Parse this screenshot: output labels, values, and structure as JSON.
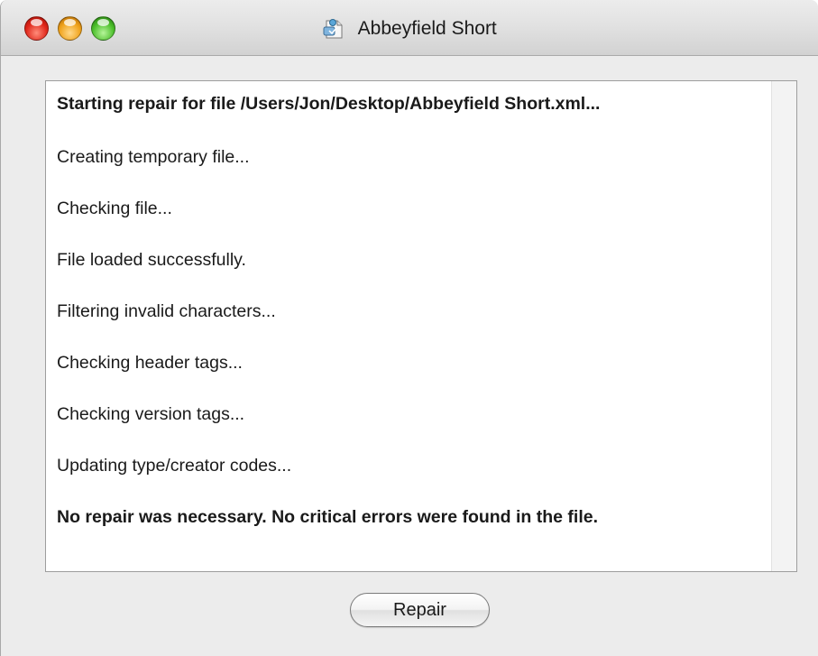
{
  "window": {
    "title": "Abbeyfield Short",
    "title_icon": "document-repair-icon"
  },
  "log": {
    "lines": [
      {
        "text": "Starting repair for file /Users/Jon/Desktop/Abbeyfield Short.xml...",
        "bold": true
      },
      {
        "text": "Creating temporary file...",
        "bold": false
      },
      {
        "text": "Checking file...",
        "bold": false
      },
      {
        "text": "File loaded successfully.",
        "bold": false
      },
      {
        "text": "Filtering invalid characters...",
        "bold": false
      },
      {
        "text": "Checking header tags...",
        "bold": false
      },
      {
        "text": "Checking version tags...",
        "bold": false
      },
      {
        "text": "Updating type/creator codes...",
        "bold": false
      },
      {
        "text": "No repair was necessary. No critical errors were found in the file.",
        "bold": true
      }
    ]
  },
  "actions": {
    "repair_label": "Repair"
  },
  "colors": {
    "close": "#e0261a",
    "minimize": "#f0a21a",
    "zoom": "#4bbf2a"
  }
}
